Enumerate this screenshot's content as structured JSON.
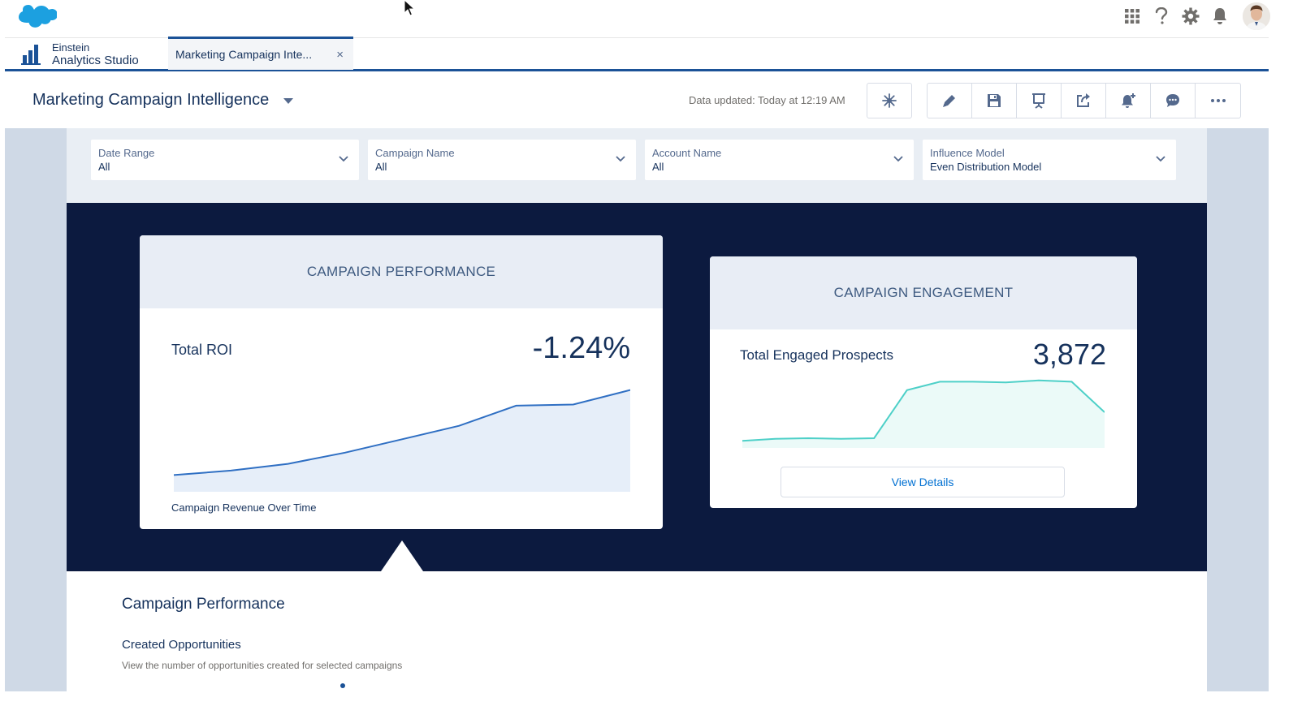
{
  "topbar": {
    "icons": [
      "app-launcher-icon",
      "help-icon",
      "gear-icon",
      "notification-bell-icon"
    ]
  },
  "appnav": {
    "app_line1": "Einstein",
    "app_line2": "Analytics Studio",
    "tab_label": "Marketing Campaign Inte...",
    "tab_close": "×"
  },
  "header": {
    "title": "Marketing Campaign Intelligence",
    "updated": "Data updated: Today at 12:19 AM"
  },
  "filters": [
    {
      "label": "Date Range",
      "value": "All"
    },
    {
      "label": "Campaign Name",
      "value": "All"
    },
    {
      "label": "Account Name",
      "value": "All"
    },
    {
      "label": "Influence Model",
      "value": "Even Distribution Model"
    }
  ],
  "performance": {
    "heading": "CAMPAIGN PERFORMANCE",
    "metric_label": "Total ROI",
    "metric_value": "-1.24%",
    "caption": "Campaign Revenue Over Time",
    "spark": [
      0.12,
      0.16,
      0.22,
      0.32,
      0.44,
      0.56,
      0.74,
      0.75,
      0.88
    ]
  },
  "engagement": {
    "heading": "CAMPAIGN ENGAGEMENT",
    "metric_label": "Total Engaged Prospects",
    "metric_value": "3,872",
    "button": "View Details",
    "spark": [
      0.06,
      0.09,
      0.1,
      0.09,
      0.1,
      0.84,
      0.97,
      0.97,
      0.96,
      0.99,
      0.97,
      0.5
    ]
  },
  "section": {
    "title": "Campaign Performance",
    "subtitle": "Created Opportunities",
    "description": "View the number of opportunities created for selected campaigns"
  },
  "colors": {
    "navy": "#0c1a3f",
    "brand_blue": "#1b5297",
    "roi_line": "#2f6fc3",
    "engage_line": "#4ed0c8"
  }
}
